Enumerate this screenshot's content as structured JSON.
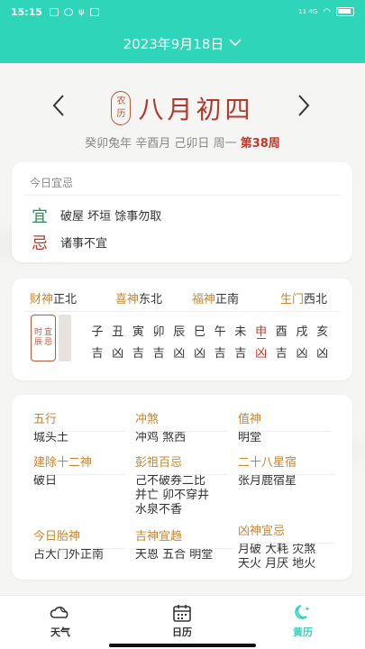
{
  "status": {
    "time": "15:15",
    "right_text": "11  4G"
  },
  "header": {
    "date": "2023年9月18日"
  },
  "lunar": {
    "seal_top": "农",
    "seal_bottom": "历",
    "date": "八月初四",
    "ganzhi": "癸卯兔年 辛酉月 己卯日 周一",
    "week": "第38周"
  },
  "yiji": {
    "title": "今日宜忌",
    "yi_char": "宜",
    "yi_text": "破屋 坏垣 馀事勿取",
    "ji_char": "忌",
    "ji_text": "诸事不宜"
  },
  "gods": [
    {
      "name": "财神",
      "dir": "正北"
    },
    {
      "name": "喜神",
      "dir": "东北"
    },
    {
      "name": "福神",
      "dir": "正南"
    },
    {
      "name": "生门",
      "dir": "西北"
    }
  ],
  "shichen": {
    "seal": [
      "时",
      "辰",
      "宜",
      "忌"
    ],
    "hours": [
      {
        "hz": "子",
        "luck": "吉"
      },
      {
        "hz": "丑",
        "luck": "凶"
      },
      {
        "hz": "寅",
        "luck": "吉"
      },
      {
        "hz": "卯",
        "luck": "吉"
      },
      {
        "hz": "辰",
        "luck": "凶"
      },
      {
        "hz": "巳",
        "luck": "凶"
      },
      {
        "hz": "午",
        "luck": "吉"
      },
      {
        "hz": "未",
        "luck": "吉"
      },
      {
        "hz": "申",
        "luck": "凶"
      },
      {
        "hz": "酉",
        "luck": "吉"
      },
      {
        "hz": "戌",
        "luck": "凶"
      },
      {
        "hz": "亥",
        "luck": "凶"
      }
    ],
    "current_index": 8
  },
  "details": [
    {
      "label": "五行",
      "value": "城头土"
    },
    {
      "label": "冲煞",
      "value": "冲鸡 煞西"
    },
    {
      "label": "值神",
      "value": "明堂"
    },
    {
      "label": "建除十二神",
      "value": "破日"
    },
    {
      "label": "彭祖百忌",
      "value": "己不破券二比\n并亡 卯不穿井\n水泉不香"
    },
    {
      "label": "二十八星宿",
      "value": "张月鹿宿星"
    },
    {
      "label": "今日胎神",
      "value": "占大门外正南"
    },
    {
      "label": "吉神宜趋",
      "value": "天恩 五合 明堂"
    },
    {
      "label": "凶神宜忌",
      "value": "月破 大耗 灾煞\n天火 月厌 地火"
    }
  ],
  "tabs": [
    {
      "label": "天气",
      "icon": "cloud-moon-icon"
    },
    {
      "label": "日历",
      "icon": "calendar-icon"
    },
    {
      "label": "黄历",
      "icon": "moon-star-icon"
    }
  ],
  "colors": {
    "accent": "#2fd5b8",
    "red": "#c0392b",
    "gold": "#c8852e",
    "green": "#2e8b57"
  }
}
